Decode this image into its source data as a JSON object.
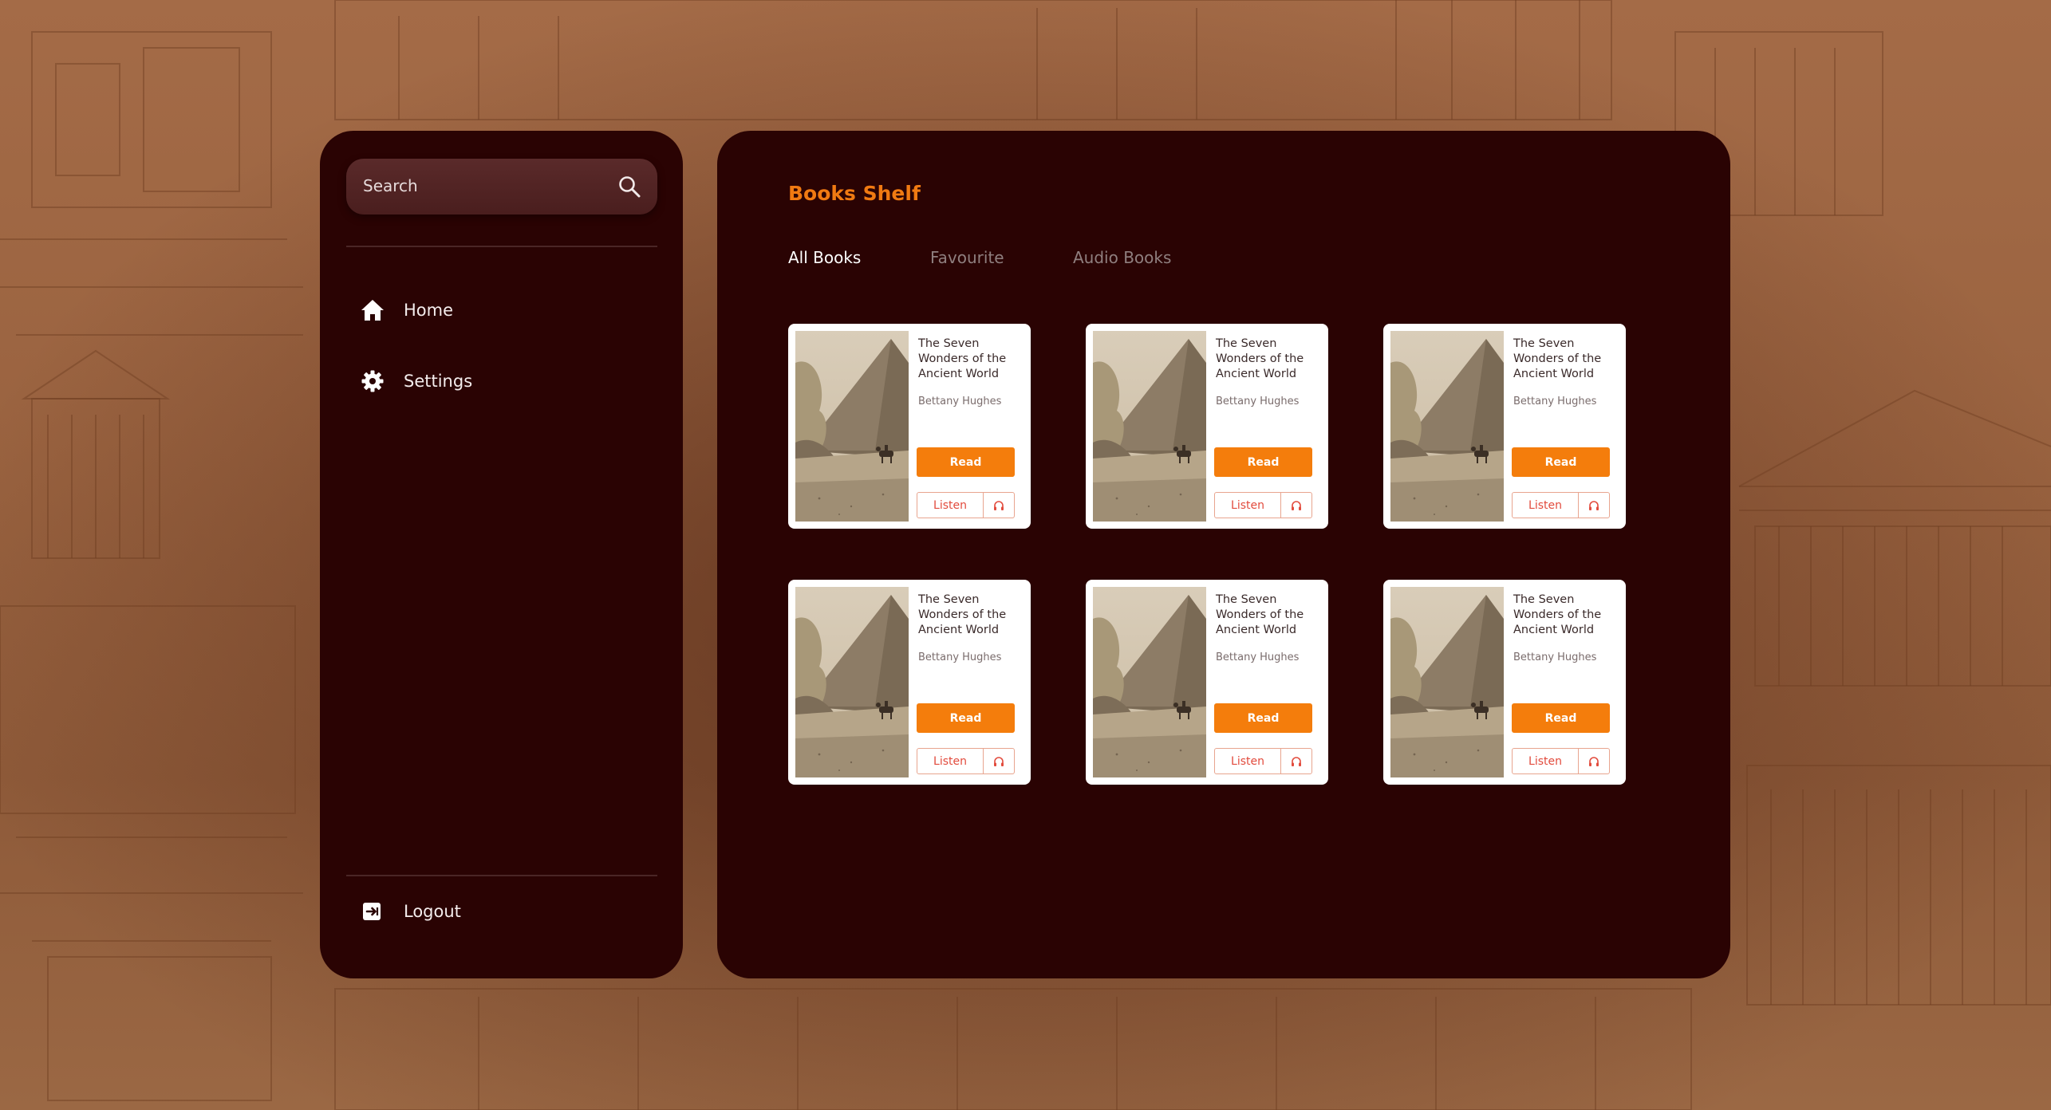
{
  "sidebar": {
    "search_placeholder": "Search",
    "items": [
      {
        "label": "Home",
        "icon": "home-icon"
      },
      {
        "label": "Settings",
        "icon": "gear-icon"
      }
    ],
    "logout_label": "Logout"
  },
  "main": {
    "title": "Books Shelf",
    "tabs": [
      {
        "label": "All Books",
        "active": true
      },
      {
        "label": "Favourite",
        "active": false
      },
      {
        "label": "Audio Books",
        "active": false
      }
    ],
    "books": [
      {
        "title": "The Seven Wonders of the Ancient World",
        "author": "Bettany Hughes",
        "read_label": "Read",
        "listen_label": "Listen"
      },
      {
        "title": "The Seven Wonders of the Ancient World",
        "author": "Bettany Hughes",
        "read_label": "Read",
        "listen_label": "Listen"
      },
      {
        "title": "The Seven Wonders of the Ancient World",
        "author": "Bettany Hughes",
        "read_label": "Read",
        "listen_label": "Listen"
      },
      {
        "title": "The Seven Wonders of the Ancient World",
        "author": "Bettany Hughes",
        "read_label": "Read",
        "listen_label": "Listen"
      },
      {
        "title": "The Seven Wonders of the Ancient World",
        "author": "Bettany Hughes",
        "read_label": "Read",
        "listen_label": "Listen"
      },
      {
        "title": "The Seven Wonders of the Ancient World",
        "author": "Bettany Hughes",
        "read_label": "Read",
        "listen_label": "Listen"
      }
    ]
  },
  "colors": {
    "panel": "#2a0303",
    "accent": "#f47d0c",
    "title_accent": "#f07a12",
    "listen_text": "#e24b3d"
  }
}
